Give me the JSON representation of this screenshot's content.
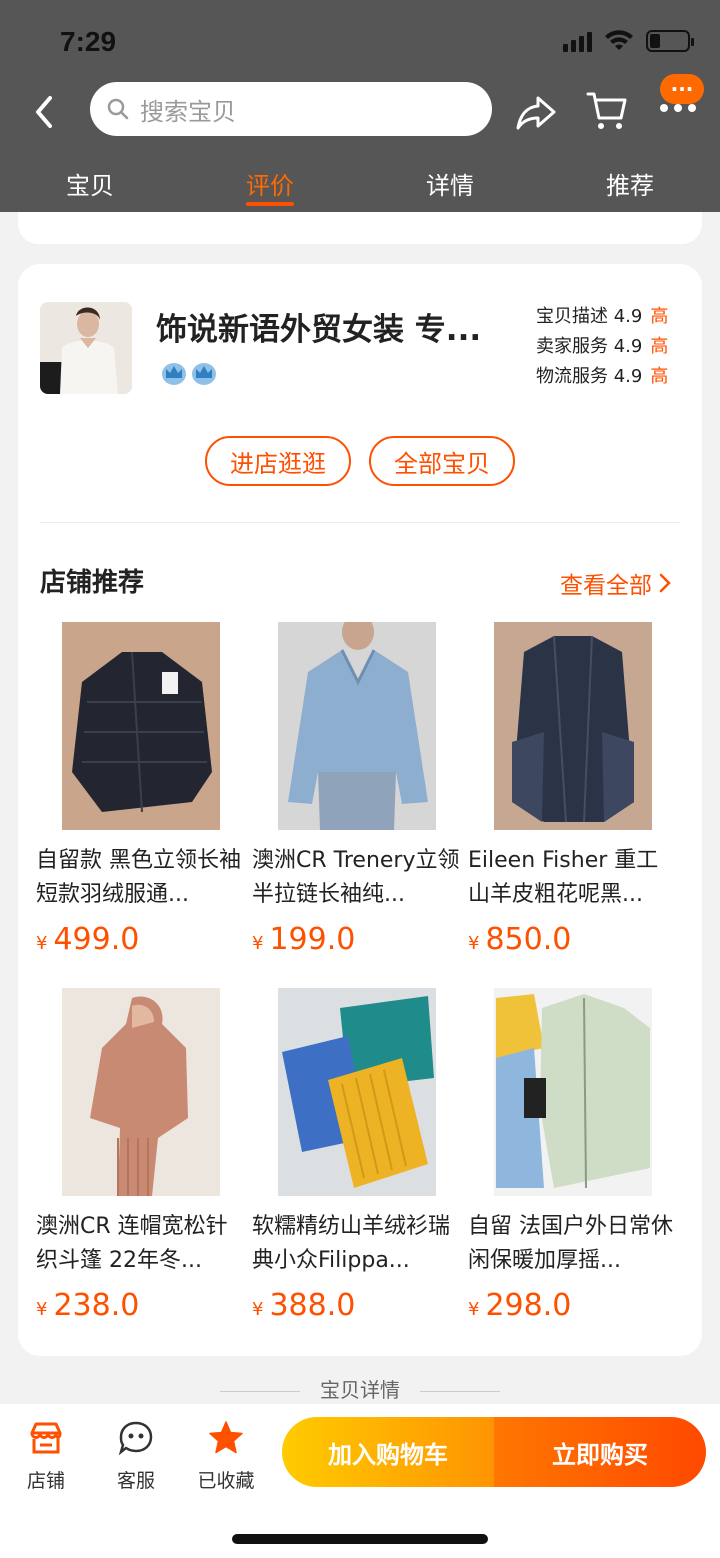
{
  "status": {
    "time": "7:29"
  },
  "header": {
    "search_placeholder": "搜索宝贝",
    "more_badge": "···"
  },
  "tabs": [
    {
      "label": "宝贝",
      "active": false
    },
    {
      "label": "评价",
      "active": true
    },
    {
      "label": "详情",
      "active": false
    },
    {
      "label": "推荐",
      "active": false
    }
  ],
  "shop": {
    "name": "饰说新语外贸女装 专...",
    "ratings": [
      {
        "label": "宝贝描述",
        "score": "4.9",
        "level": "高"
      },
      {
        "label": "卖家服务",
        "score": "4.9",
        "level": "高"
      },
      {
        "label": "物流服务",
        "score": "4.9",
        "level": "高"
      }
    ],
    "enter_label": "进店逛逛",
    "all_label": "全部宝贝"
  },
  "recommend": {
    "title": "店铺推荐",
    "more_label": "查看全部",
    "products": [
      {
        "title": "自留款 黑色立领长袖短款羽绒服通...",
        "currency": "¥",
        "price": "499.0"
      },
      {
        "title": "澳洲CR Trenery立领半拉链长袖纯...",
        "currency": "¥",
        "price": "199.0"
      },
      {
        "title": "Eileen Fisher 重工山羊皮粗花呢黑...",
        "currency": "¥",
        "price": "850.0"
      },
      {
        "title": "澳洲CR 连帽宽松针织斗篷 22年冬...",
        "currency": "¥",
        "price": "238.0"
      },
      {
        "title": "软糯精纺山羊绒衫瑞典小众Filippa...",
        "currency": "¥",
        "price": "388.0"
      },
      {
        "title": "自留 法国户外日常休闲保暖加厚摇...",
        "currency": "¥",
        "price": "298.0"
      }
    ]
  },
  "detail_separator": "宝贝详情",
  "bottom": {
    "shop_label": "店铺",
    "service_label": "客服",
    "fav_label": "已收藏",
    "cart_label": "加入购物车",
    "buy_label": "立即购买"
  },
  "colors": {
    "accent": "#ff5000",
    "header_bg": "#565656"
  }
}
